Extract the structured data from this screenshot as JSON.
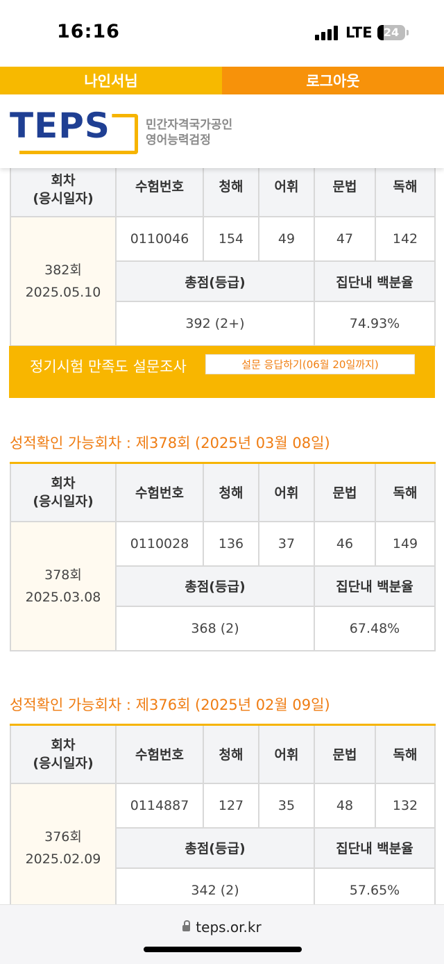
{
  "status_bar": {
    "time": "16:16",
    "network": "LTE",
    "battery": "24"
  },
  "topbar": {
    "user_label": "나인서님",
    "logout_label": "로그아웃"
  },
  "header": {
    "logo_text": "TEPS",
    "tagline_line1": "민간자격국가공인",
    "tagline_line2": "영어능력검정"
  },
  "headers": {
    "round_line1": "회차",
    "round_line2": "(응시일자)",
    "exam_no": "수험번호",
    "listening": "청해",
    "vocabulary": "어휘",
    "grammar": "문법",
    "reading": "독해",
    "total": "총점(등급)",
    "percentile": "집단내 백분율"
  },
  "survey": {
    "title": "정기시험 만족도 설문조사",
    "button_label": "설문 응답하기(06월 20일까지)"
  },
  "results": [
    {
      "section_title": "",
      "round": "382회",
      "date": "2025.05.10",
      "exam_no": "0110046",
      "listening": "154",
      "vocabulary": "49",
      "grammar": "47",
      "reading": "142",
      "total": "392 (2+)",
      "percentile": "74.93%"
    },
    {
      "section_title": "성적확인 가능회차 : 제378회 (2025년 03월 08일)",
      "round": "378회",
      "date": "2025.03.08",
      "exam_no": "0110028",
      "listening": "136",
      "vocabulary": "37",
      "grammar": "46",
      "reading": "149",
      "total": "368 (2)",
      "percentile": "67.48%"
    },
    {
      "section_title": "성적확인 가능회차 : 제376회 (2025년 02월 09일)",
      "round": "376회",
      "date": "2025.02.09",
      "exam_no": "0114887",
      "listening": "127",
      "vocabulary": "35",
      "grammar": "48",
      "reading": "132",
      "total": "342 (2)",
      "percentile": "57.65%"
    }
  ],
  "browser": {
    "url": "teps.or.kr"
  },
  "colors": {
    "accent_yellow": "#f7b900",
    "accent_orange": "#f7920a",
    "title_orange": "#ef7c12",
    "logo_blue": "#1f3f93"
  }
}
